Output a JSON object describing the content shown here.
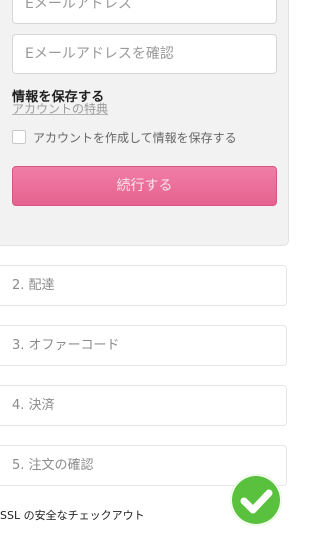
{
  "form": {
    "email_placeholder": "Eメールアドレス",
    "email_confirm_placeholder": "Eメールアドレスを確認",
    "save_info_title": "情報を保存する",
    "account_benefits_link": "アカウントの特典",
    "create_account_checkbox_label": "アカウントを作成して情報を保存する",
    "continue_button": "続行する"
  },
  "steps": [
    {
      "label": "2. 配達"
    },
    {
      "label": "3. オファーコード"
    },
    {
      "label": "4. 決済"
    },
    {
      "label": "5. 注文の確認"
    }
  ],
  "footer": {
    "ssl_text": "SSL の安全なチェックアウト",
    "badge_icon": "check-circle-icon"
  },
  "colors": {
    "accent": "#e96d98",
    "badge": "#59c13e",
    "panel_bg": "#f2f2f2"
  }
}
